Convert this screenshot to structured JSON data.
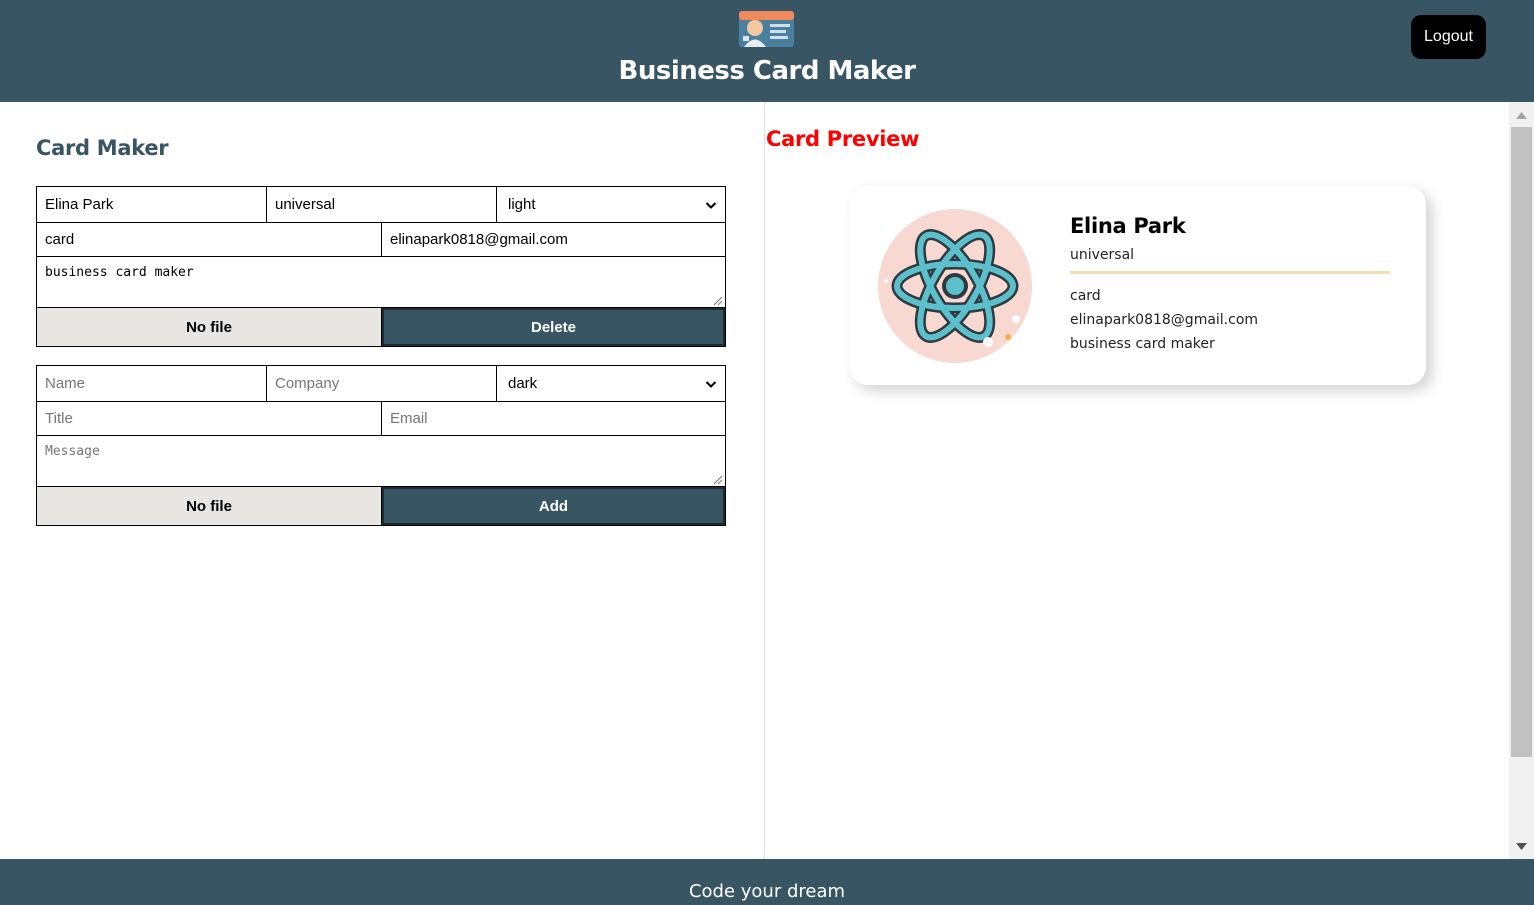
{
  "header": {
    "title": "Business Card Maker",
    "logout_label": "Logout",
    "logo_icon": "business-card-logo-icon"
  },
  "maker": {
    "title": "Card Maker",
    "cards": [
      {
        "name": "Elina Park",
        "company": "universal",
        "theme": "light",
        "title": "card",
        "email": "elinapark0818@gmail.com",
        "message": "business card maker",
        "file_label": "No file",
        "action_label": "Delete"
      }
    ],
    "add_form": {
      "name_placeholder": "Name",
      "company_placeholder": "Company",
      "theme": "dark",
      "title_placeholder": "Title",
      "email_placeholder": "Email",
      "message_placeholder": "Message",
      "file_label": "No file",
      "action_label": "Add"
    }
  },
  "preview": {
    "title": "Card Preview",
    "cards": [
      {
        "name": "Elina Park",
        "company": "universal",
        "title": "card",
        "email": "elinapark0818@gmail.com",
        "message": "business card maker",
        "avatar_icon": "react-atom-icon"
      }
    ]
  },
  "footer": {
    "text": "Code your dream"
  },
  "colors": {
    "primary": "#385563",
    "preview_title": "#ff0000",
    "avatar_bg": "#f8d9d2",
    "divider": "#f6dcb5",
    "file_button": "#e8e6e3"
  }
}
